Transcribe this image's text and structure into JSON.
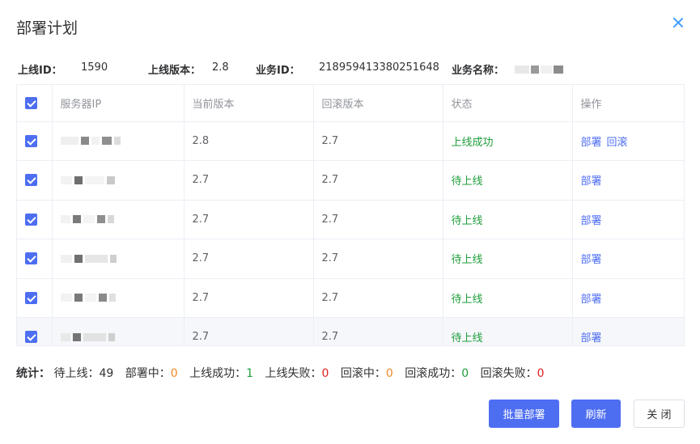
{
  "dialog": {
    "title": "部署计划"
  },
  "info": {
    "launch_id_label": "上线ID：",
    "launch_id_value": "1590",
    "version_label": "上线版本：",
    "version_value": "2.8",
    "business_id_label": "业务ID：",
    "business_id_value": "218959413380251648",
    "business_name_label": "业务名称："
  },
  "table": {
    "headers": [
      "服务器IP",
      "当前版本",
      "回滚版本",
      "状态",
      "操作"
    ],
    "rows": [
      {
        "current": "2.8",
        "rollback": "2.7",
        "status": "上线成功",
        "ops": [
          "部署",
          "回滚"
        ]
      },
      {
        "current": "2.7",
        "rollback": "2.7",
        "status": "待上线",
        "ops": [
          "部署"
        ]
      },
      {
        "current": "2.7",
        "rollback": "2.7",
        "status": "待上线",
        "ops": [
          "部署"
        ]
      },
      {
        "current": "2.7",
        "rollback": "2.7",
        "status": "待上线",
        "ops": [
          "部署"
        ]
      },
      {
        "current": "2.7",
        "rollback": "2.7",
        "status": "待上线",
        "ops": [
          "部署"
        ]
      },
      {
        "current": "2.7",
        "rollback": "2.7",
        "status": "待上线",
        "ops": [
          "部署"
        ]
      }
    ]
  },
  "stats": {
    "label": "统计：",
    "pending_label": "待上线：",
    "pending_value": "49",
    "deploying_label": "部署中：",
    "deploying_value": "0",
    "success_label": "上线成功：",
    "success_value": "1",
    "failed_label": "上线失败：",
    "failed_value": "0",
    "rolling_label": "回滚中：",
    "rolling_value": "0",
    "rollback_success_label": "回滚成功：",
    "rollback_success_value": "0",
    "rollback_failed_label": "回滚失败：",
    "rollback_failed_value": "0"
  },
  "buttons": {
    "batch_deploy": "批量部署",
    "refresh": "刷新",
    "close": "关 闭"
  },
  "colors": {
    "primary": "#4e6ef2",
    "success": "#1e9e3a",
    "warning": "#f08a24",
    "danger": "#e02020"
  },
  "icons": {
    "close": "close-icon",
    "checkbox": "checkbox-checked-icon"
  }
}
